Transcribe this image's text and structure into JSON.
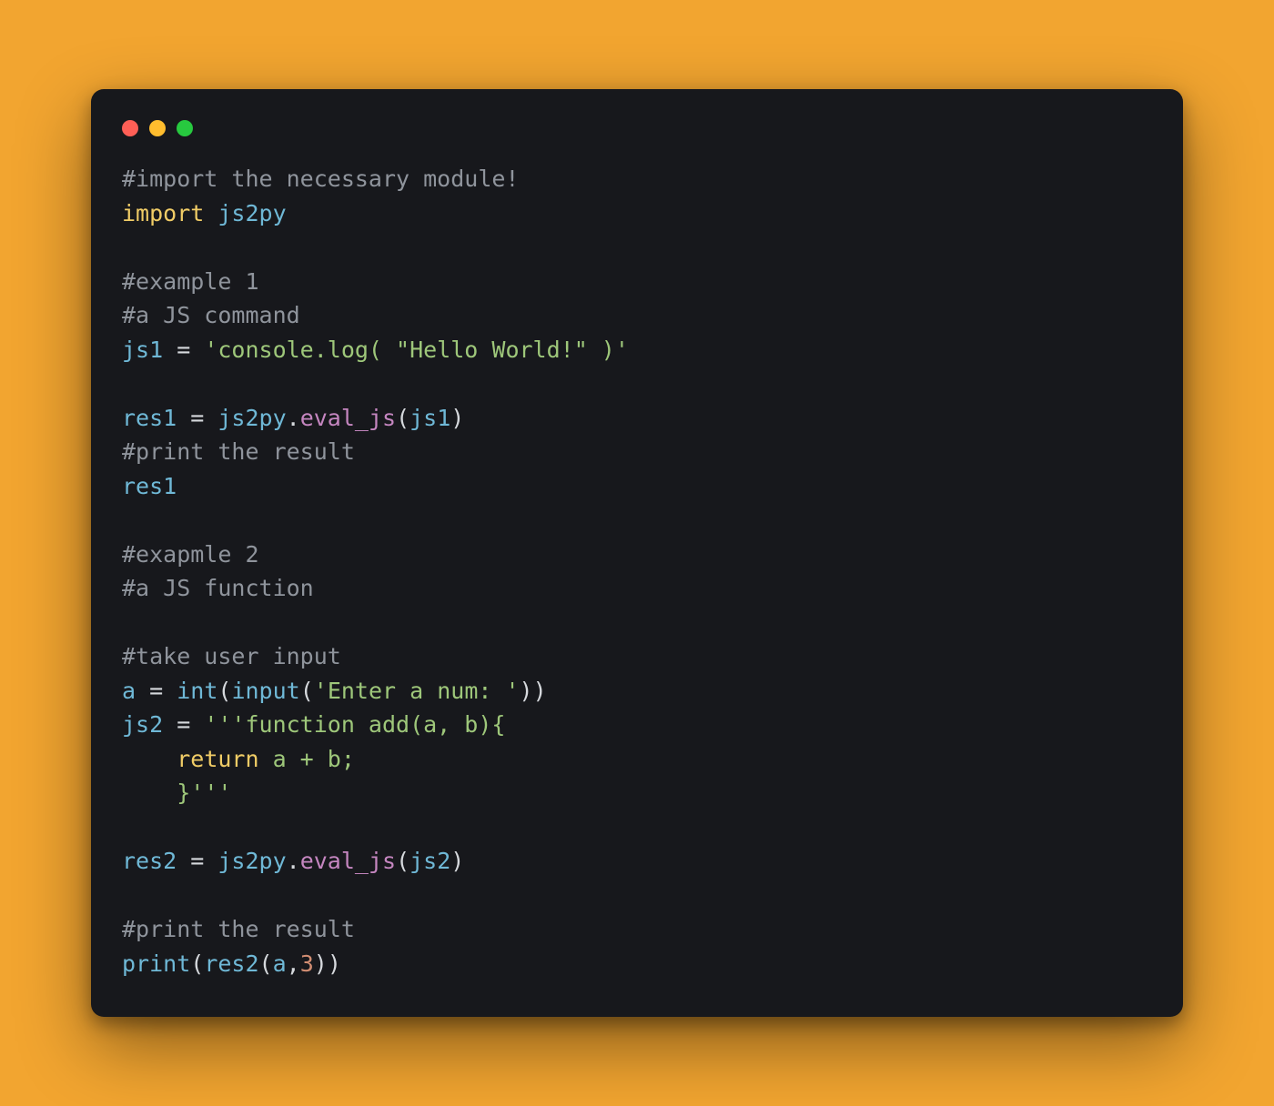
{
  "window": {
    "traffic_lights": [
      "red",
      "yellow",
      "green"
    ]
  },
  "code": {
    "tokens": [
      [
        {
          "t": "#import the necessary module!",
          "c": "tok-comment"
        }
      ],
      [
        {
          "t": "import",
          "c": "tok-keyword"
        },
        {
          "t": " ",
          "c": "tok-op"
        },
        {
          "t": "js2py",
          "c": "tok-module"
        }
      ],
      [],
      [
        {
          "t": "#example 1",
          "c": "tok-comment"
        }
      ],
      [
        {
          "t": "#a JS command",
          "c": "tok-comment"
        }
      ],
      [
        {
          "t": "js1",
          "c": "tok-ident"
        },
        {
          "t": " = ",
          "c": "tok-op"
        },
        {
          "t": "'console.log( \"Hello World!\" )'",
          "c": "tok-string"
        }
      ],
      [],
      [
        {
          "t": "res1",
          "c": "tok-ident"
        },
        {
          "t": " = ",
          "c": "tok-op"
        },
        {
          "t": "js2py",
          "c": "tok-module"
        },
        {
          "t": ".",
          "c": "tok-op"
        },
        {
          "t": "eval_js",
          "c": "tok-func"
        },
        {
          "t": "(",
          "c": "tok-paren"
        },
        {
          "t": "js1",
          "c": "tok-ident"
        },
        {
          "t": ")",
          "c": "tok-paren"
        }
      ],
      [
        {
          "t": "#print the result",
          "c": "tok-comment"
        }
      ],
      [
        {
          "t": "res1",
          "c": "tok-ident"
        }
      ],
      [],
      [
        {
          "t": "#exapmle 2",
          "c": "tok-comment"
        }
      ],
      [
        {
          "t": "#a JS function",
          "c": "tok-comment"
        }
      ],
      [],
      [
        {
          "t": "#take user input",
          "c": "tok-comment"
        }
      ],
      [
        {
          "t": "a",
          "c": "tok-ident"
        },
        {
          "t": " = ",
          "c": "tok-op"
        },
        {
          "t": "int",
          "c": "tok-builtin"
        },
        {
          "t": "(",
          "c": "tok-paren"
        },
        {
          "t": "input",
          "c": "tok-builtin"
        },
        {
          "t": "(",
          "c": "tok-paren"
        },
        {
          "t": "'Enter a num: '",
          "c": "tok-string"
        },
        {
          "t": ")",
          "c": "tok-paren"
        },
        {
          "t": ")",
          "c": "tok-paren"
        }
      ],
      [
        {
          "t": "js2",
          "c": "tok-ident"
        },
        {
          "t": " = ",
          "c": "tok-op"
        },
        {
          "t": "'''function add(a, b){",
          "c": "tok-string"
        }
      ],
      [
        {
          "t": "    ",
          "c": "tok-op"
        },
        {
          "t": "return",
          "c": "tok-keyword"
        },
        {
          "t": " a + b;",
          "c": "tok-string"
        }
      ],
      [
        {
          "t": "    }",
          "c": "tok-string"
        },
        {
          "t": "'''",
          "c": "tok-string"
        }
      ],
      [],
      [
        {
          "t": "res2",
          "c": "tok-ident"
        },
        {
          "t": " = ",
          "c": "tok-op"
        },
        {
          "t": "js2py",
          "c": "tok-module"
        },
        {
          "t": ".",
          "c": "tok-op"
        },
        {
          "t": "eval_js",
          "c": "tok-func"
        },
        {
          "t": "(",
          "c": "tok-paren"
        },
        {
          "t": "js2",
          "c": "tok-ident"
        },
        {
          "t": ")",
          "c": "tok-paren"
        }
      ],
      [],
      [
        {
          "t": "#print the result",
          "c": "tok-comment"
        }
      ],
      [
        {
          "t": "print",
          "c": "tok-builtin"
        },
        {
          "t": "(",
          "c": "tok-paren"
        },
        {
          "t": "res2",
          "c": "tok-ident"
        },
        {
          "t": "(",
          "c": "tok-paren"
        },
        {
          "t": "a",
          "c": "tok-ident"
        },
        {
          "t": ",",
          "c": "tok-op"
        },
        {
          "t": "3",
          "c": "tok-number"
        },
        {
          "t": ")",
          "c": "tok-paren"
        },
        {
          "t": ")",
          "c": "tok-paren"
        }
      ]
    ]
  }
}
